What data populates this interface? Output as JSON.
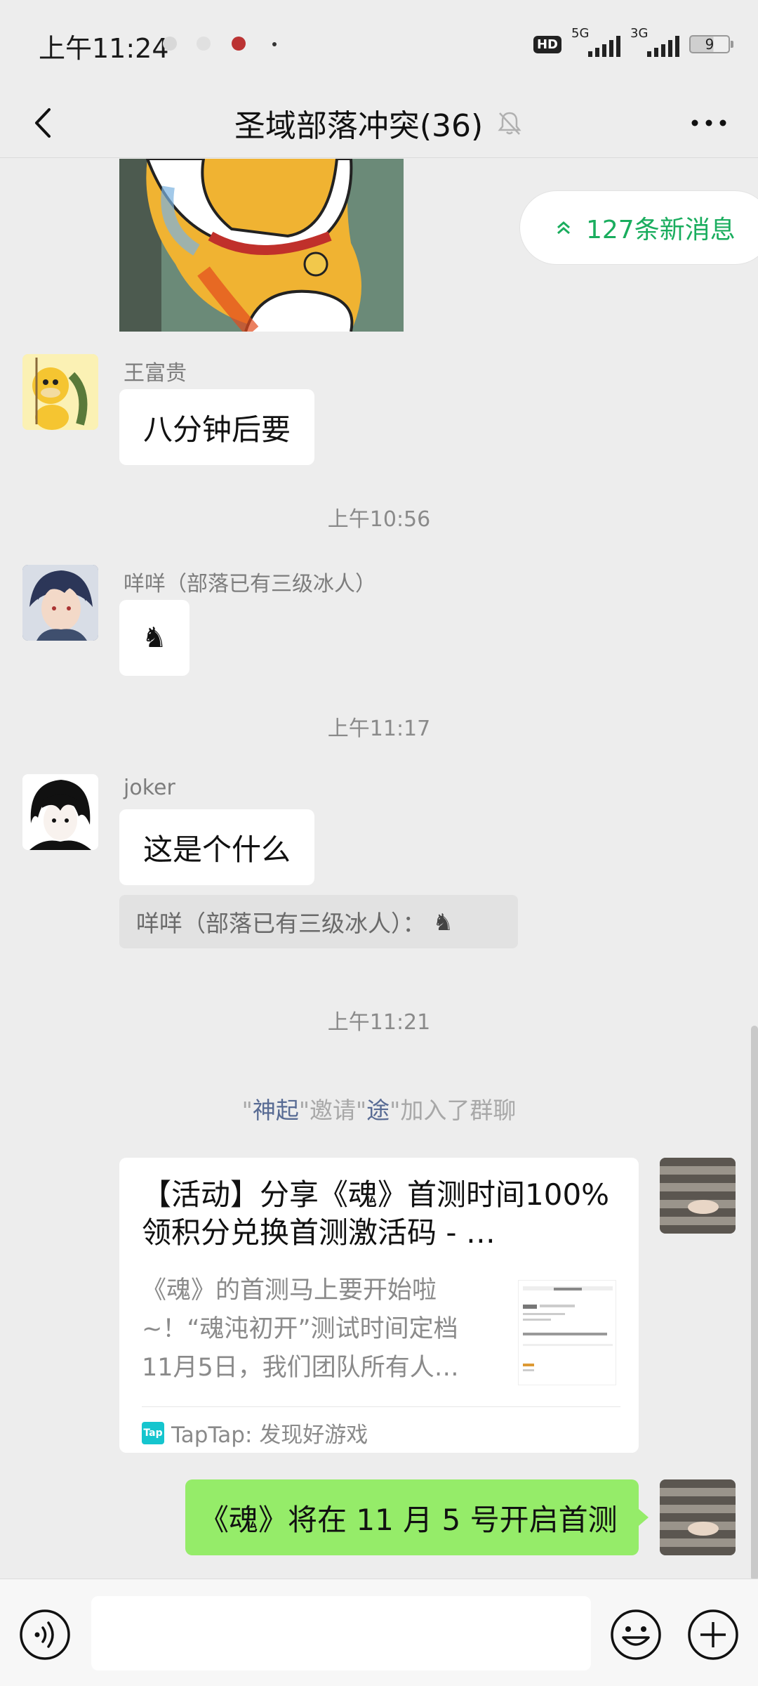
{
  "status": {
    "time": "上午11:24",
    "hd": "HD",
    "net1": "5G",
    "net2": "3G",
    "battery": "9"
  },
  "header": {
    "title": "圣域部落冲突(36)"
  },
  "new_messages": {
    "label": "127条新消息"
  },
  "messages": {
    "m1": {
      "sender": "王富贵",
      "text": "八分钟后要"
    },
    "t1": "上午10:56",
    "m2": {
      "sender": "咩咩（部落已有三级冰人）",
      "text": "♞"
    },
    "t2": "上午11:17",
    "m3": {
      "sender": "joker",
      "text": "这是个什么",
      "quote": "咩咩（部落已有三级冰人）：",
      "quote_icon": "♞"
    },
    "t3": "上午11:21",
    "sys": {
      "q1": "\"",
      "name1": "神起",
      "mid": "\"邀请\"",
      "name2": "途",
      "end": "\"加入了群聊"
    },
    "card": {
      "title": "【活动】分享《魂》首测时间100%领积分兑换首测激活码 - …",
      "desc": "《魂》的首测马上要开始啦~！“魂沌初开”测试时间定档11月5日，我们团队所有人…",
      "source": "TapTap: 发现好游戏",
      "logo": "Tap"
    },
    "me_text": "《魂》将在 11 月 5 号开启首测"
  },
  "input": {
    "value": ""
  },
  "colors": {
    "accent_green": "#1aad5e",
    "my_bubble": "#95ec69",
    "background": "#ededed"
  }
}
